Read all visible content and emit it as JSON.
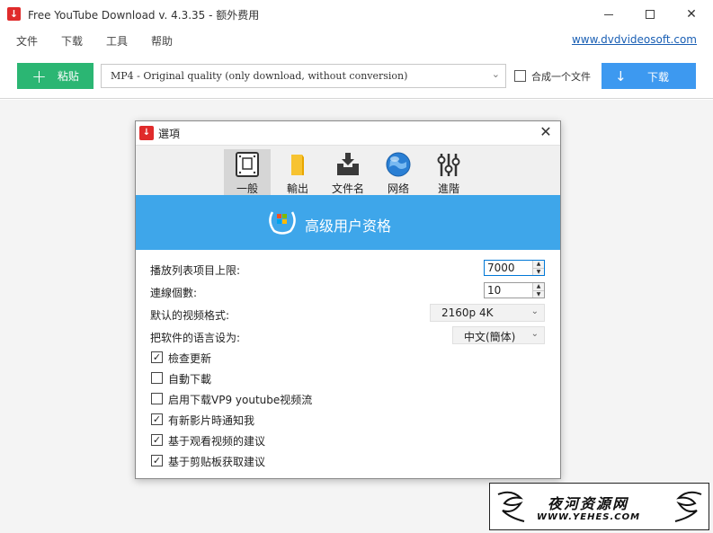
{
  "window": {
    "title": "Free YouTube Download v. 4.3.35 - 额外费用",
    "minimize": "—",
    "maximize": "□",
    "close": "✕"
  },
  "menu": {
    "items": [
      "文件",
      "下载",
      "工具",
      "帮助"
    ],
    "site_link": "www.dvdvideosoft.com"
  },
  "toolbar": {
    "paste_icon": "+",
    "paste_label": "粘贴",
    "format_value": "MP4 - Original quality (only download, without conversion)",
    "merge_checked": false,
    "merge_label": "合成一个文件",
    "download_label": "下载",
    "download_icon": "↓",
    "accent_green": "#2bb673",
    "accent_blue": "#3d99f0"
  },
  "dialog": {
    "title": "選項",
    "close": "✕",
    "tabs": [
      {
        "label": "一般",
        "icon": "general-icon",
        "active": true
      },
      {
        "label": "輸出",
        "icon": "folder-icon",
        "active": false
      },
      {
        "label": "文件名",
        "icon": "filename-icon",
        "active": false
      },
      {
        "label": "网络",
        "icon": "globe-icon",
        "active": false
      },
      {
        "label": "進階",
        "icon": "sliders-icon",
        "active": false
      }
    ],
    "premium_text": "高级用户资格",
    "premium_color": "#3ea6ea",
    "fields": {
      "playlist_limit_label": "播放列表项目上限:",
      "playlist_limit_value": "7000",
      "connections_label": "連線個數:",
      "connections_value": "10",
      "default_format_label": "默认的视频格式:",
      "default_format_value": "2160p 4K",
      "language_label": "把软件的语言设为:",
      "language_value": "中文(簡体)"
    },
    "checkboxes": [
      {
        "label": "檢查更新",
        "checked": true
      },
      {
        "label": "自動下載",
        "checked": false
      },
      {
        "label": "启用下载VP9 youtube视频流",
        "checked": false
      },
      {
        "label": "有新影片時通知我",
        "checked": true
      },
      {
        "label": "基于观看视频的建议",
        "checked": true
      },
      {
        "label": "基于剪贴板获取建议",
        "checked": true
      }
    ]
  },
  "watermark": {
    "text": "夜河资源网",
    "url": "WWW.YEHES.COM"
  }
}
